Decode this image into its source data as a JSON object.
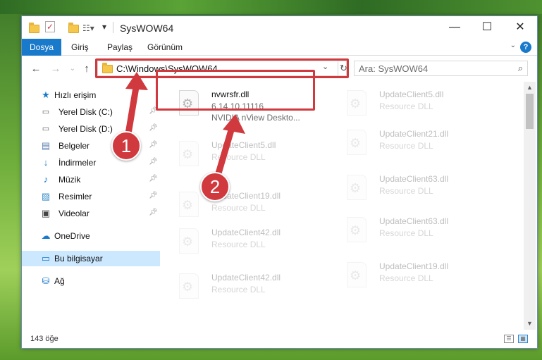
{
  "window": {
    "title": "SysWOW64",
    "controls": {
      "minimize": "—",
      "maximize": "☐",
      "close": "✕"
    }
  },
  "ribbon": {
    "tabs": [
      "Dosya",
      "Giriş",
      "Paylaş",
      "Görünüm"
    ],
    "help": "?"
  },
  "nav": {
    "address": "C:\\Windows\\SysWOW64",
    "search_placeholder": "Ara: SysWOW64"
  },
  "sidebar": {
    "quick_access": "Hızlı erişim",
    "items": [
      {
        "label": "Yerel Disk (C:)",
        "icon": "drive-icon"
      },
      {
        "label": "Yerel Disk (D:)",
        "icon": "drive-icon"
      },
      {
        "label": "Belgeler",
        "icon": "documents-icon"
      },
      {
        "label": "İndirmeler",
        "icon": "download-icon"
      },
      {
        "label": "Müzik",
        "icon": "music-icon"
      },
      {
        "label": "Resimler",
        "icon": "pictures-icon"
      },
      {
        "label": "Videolar",
        "icon": "videos-icon"
      }
    ],
    "onedrive": "OneDrive",
    "this_pc": "Bu bilgisayar",
    "network": "Ağ"
  },
  "files": {
    "left": [
      {
        "name": "nvwrsfr.dll",
        "line2": "6.14.10.11116",
        "line3": "NVIDIA nView Deskto..."
      },
      {
        "name": "UpdateClient5.dll",
        "line2": "Resource DLL"
      },
      {
        "name": "UpdateClient19.dll",
        "line2": "Resource DLL"
      },
      {
        "name": "UpdateClient42.dll",
        "line2": "Resource DLL"
      },
      {
        "name": "UpdateClient42.dll",
        "line2": "Resource DLL"
      }
    ],
    "right": [
      {
        "name": "UpdateClient5.dll",
        "line2": "Resource DLL"
      },
      {
        "name": "UpdateClient21.dll",
        "line2": "Resource DLL"
      },
      {
        "name": "UpdateClient63.dll",
        "line2": "Resource DLL"
      },
      {
        "name": "UpdateClient63.dll",
        "line2": "Resource DLL"
      },
      {
        "name": "UpdateClient19.dll",
        "line2": "Resource DLL"
      }
    ]
  },
  "status": {
    "count": "143 öğe"
  },
  "annotations": {
    "marker1": "1",
    "marker2": "2"
  },
  "colors": {
    "accent": "#1979ca",
    "highlight": "#d0393e",
    "selected": "#cce8ff"
  }
}
